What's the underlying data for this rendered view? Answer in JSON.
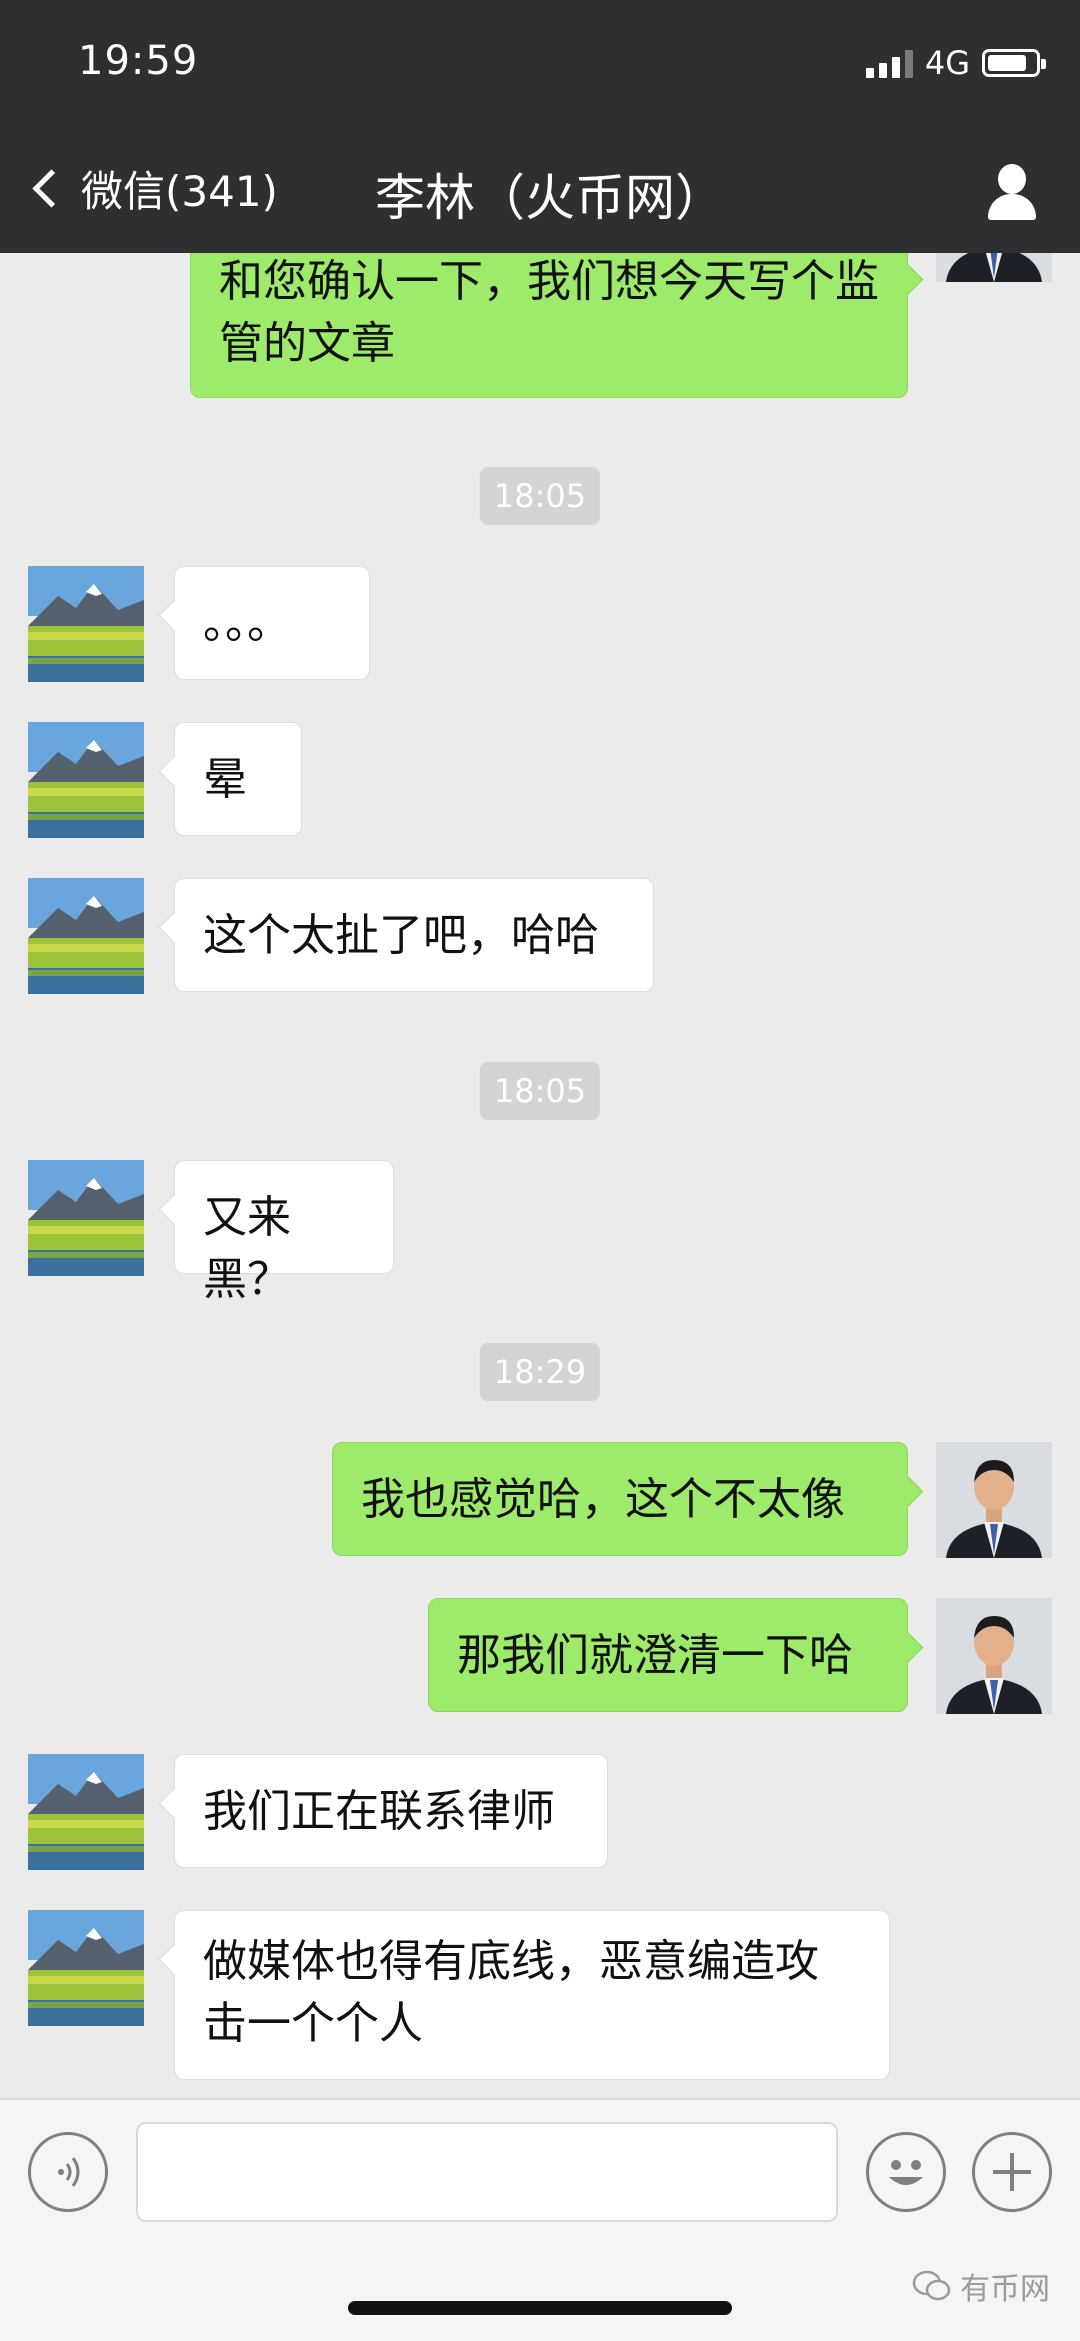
{
  "status_bar": {
    "time": "19:59",
    "network": "4G"
  },
  "nav": {
    "back_label": "微信(341)",
    "title": "李林（火币网）"
  },
  "messages": [
    {
      "type": "out",
      "text": "和您确认一下，我们想今天写个监管的文章"
    },
    {
      "type": "timestamp",
      "text": "18:05"
    },
    {
      "type": "in",
      "text": "。。。"
    },
    {
      "type": "in",
      "text": "晕"
    },
    {
      "type": "in",
      "text": "这个太扯了吧，哈哈"
    },
    {
      "type": "timestamp",
      "text": "18:05"
    },
    {
      "type": "in",
      "text": "又来黑？"
    },
    {
      "type": "timestamp",
      "text": "18:29"
    },
    {
      "type": "out",
      "text": "我也感觉哈，这个不太像"
    },
    {
      "type": "out",
      "text": "那我们就澄清一下哈"
    },
    {
      "type": "in",
      "text": "我们正在联系律师"
    },
    {
      "type": "in",
      "text": "做媒体也得有底线，恶意编造攻击一个个人"
    }
  ],
  "input_bar": {
    "text_value": ""
  },
  "watermark": {
    "text": "有币网"
  },
  "colors": {
    "header_bg": "#2e2f31",
    "chat_bg": "#ebebeb",
    "outgoing_bubble": "#9eea6a",
    "incoming_bubble": "#ffffff",
    "timestamp_bg": "#d4d4d4"
  }
}
